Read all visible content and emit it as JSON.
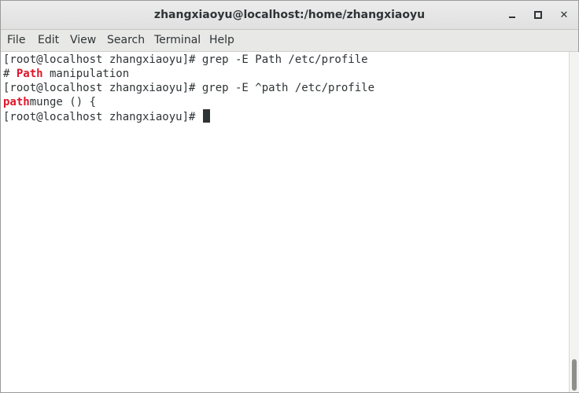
{
  "window": {
    "title": "zhangxiaoyu@localhost:/home/zhangxiaoyu",
    "minimize_icon": "minimize-icon",
    "maximize_icon": "maximize-icon",
    "close_icon": "close-icon",
    "close_glyph": "✕"
  },
  "menu": [
    "File",
    "Edit",
    "View",
    "Search",
    "Terminal",
    "Help"
  ],
  "terminal": {
    "lines": [
      {
        "segments": [
          {
            "text": "[root@localhost zhangxiaoyu]# grep -E Path /etc/profile",
            "highlight": false
          }
        ]
      },
      {
        "segments": [
          {
            "text": "# ",
            "highlight": false
          },
          {
            "text": "Path",
            "highlight": true
          },
          {
            "text": " manipulation",
            "highlight": false
          }
        ]
      },
      {
        "segments": [
          {
            "text": "[root@localhost zhangxiaoyu]# grep -E ^path /etc/profile",
            "highlight": false
          }
        ]
      },
      {
        "segments": [
          {
            "text": "path",
            "highlight": true
          },
          {
            "text": "munge () {",
            "highlight": false
          }
        ]
      },
      {
        "segments": [
          {
            "text": "[root@localhost zhangxiaoyu]# ",
            "highlight": false
          }
        ]
      }
    ],
    "highlight_color": "#e0162b",
    "text_color": "#2e3436"
  }
}
